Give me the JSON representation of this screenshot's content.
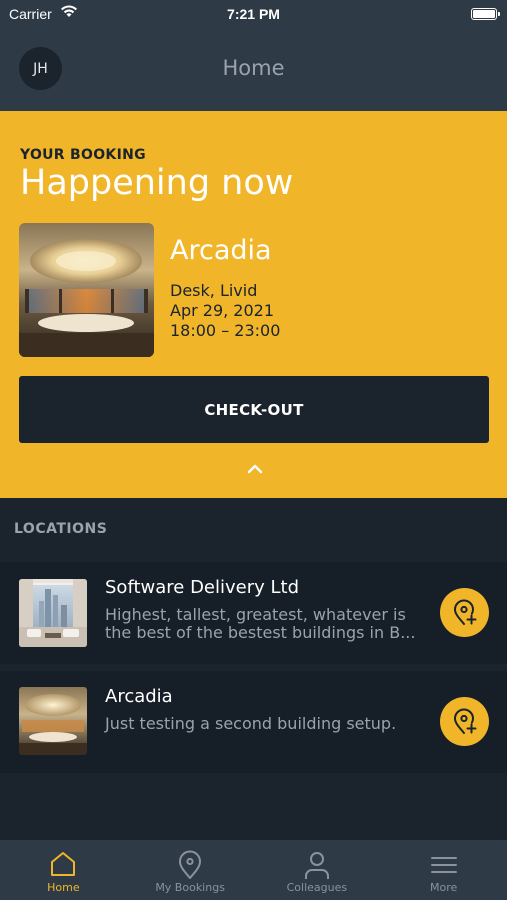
{
  "status_bar": {
    "carrier": "Carrier",
    "time": "7:21 PM"
  },
  "nav": {
    "avatar_initials": "JH",
    "title": "Home"
  },
  "booking": {
    "eyebrow": "YOUR BOOKING",
    "headline": "Happening now",
    "place": "Arcadia",
    "resource": "Desk, Livid",
    "date": "Apr 29, 2021",
    "time_range": "18:00 – 23:00",
    "checkout_label": "CHECK-OUT"
  },
  "locations": {
    "section_title": "LOCATIONS",
    "items": [
      {
        "name": "Software Delivery Ltd",
        "description_line1": "Highest, tallest, greatest, whatever is",
        "description_line2": "the best of the bestest buildings in B..."
      },
      {
        "name": "Arcadia",
        "description_line1": "Just testing a second building setup.",
        "description_line2": ""
      }
    ]
  },
  "tabs": [
    {
      "label": "Home",
      "icon": "home-icon",
      "active": true
    },
    {
      "label": "My Bookings",
      "icon": "map-pin-icon",
      "active": false
    },
    {
      "label": "Colleagues",
      "icon": "person-icon",
      "active": false
    },
    {
      "label": "More",
      "icon": "menu-icon",
      "active": false
    }
  ],
  "colors": {
    "accent": "#f0b528",
    "background": "#1b232d",
    "bar": "#2e3a46"
  }
}
